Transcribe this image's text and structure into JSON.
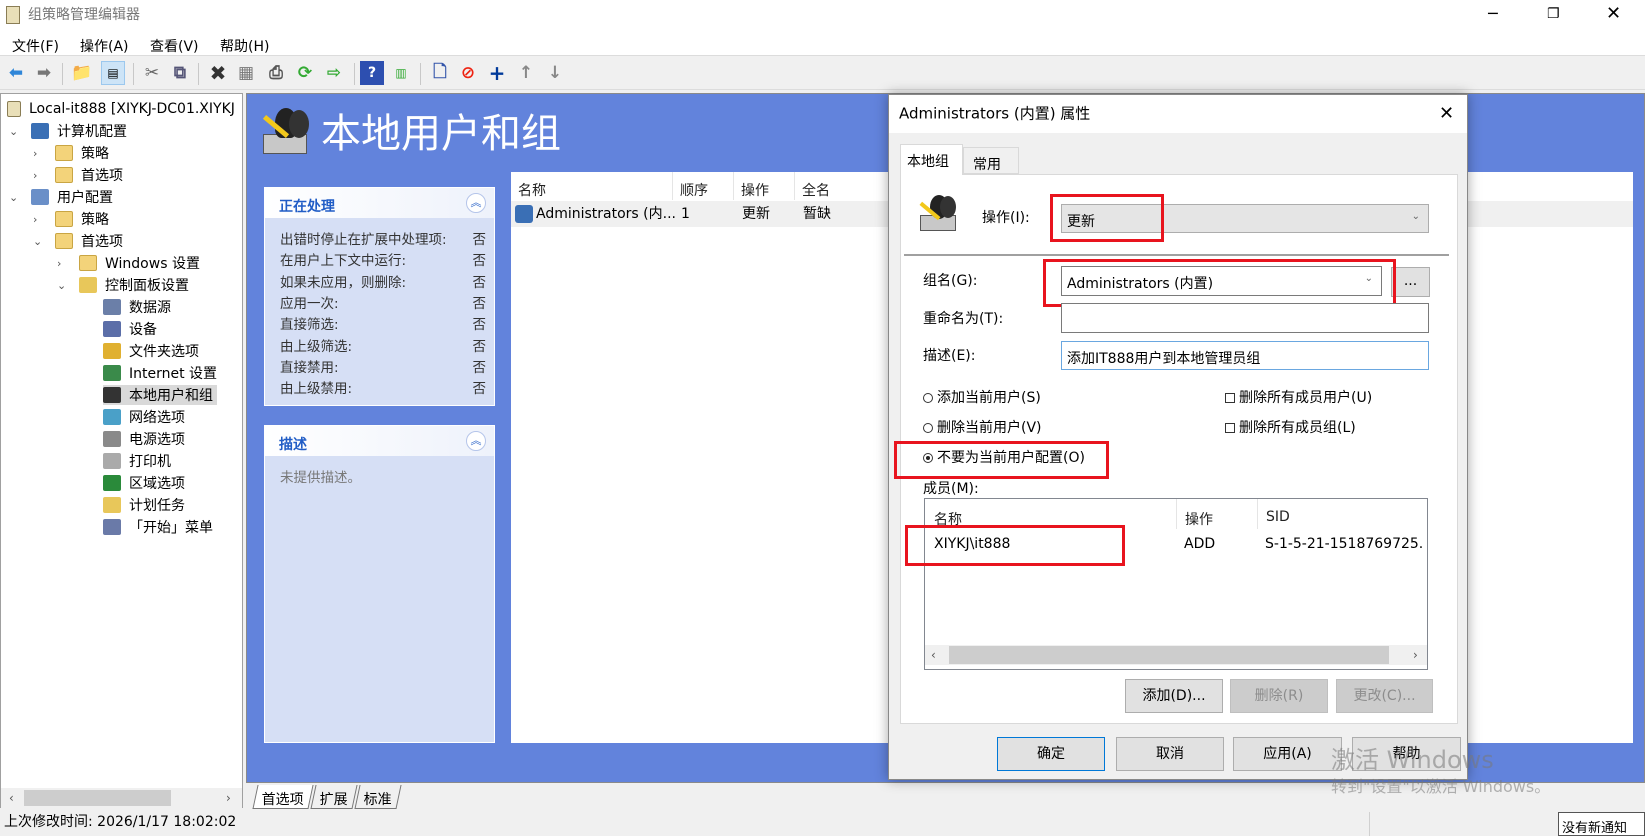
{
  "window": {
    "title": "组策略管理编辑器"
  },
  "menu": [
    "文件(F)",
    "操作(A)",
    "查看(V)",
    "帮助(H)"
  ],
  "toolbar": [
    "back-icon",
    "forward-icon",
    "up-folder-icon",
    "show-hide-tree-icon",
    "cut-icon",
    "copy-icon",
    "delete-icon",
    "properties-icon",
    "print-icon",
    "refresh-icon",
    "export-icon",
    "help-icon",
    "action-pane-icon",
    "new-item-icon",
    "disable-icon",
    "add-icon",
    "move-up-icon",
    "move-down-icon"
  ],
  "tree": {
    "root": "Local-it888 [XIYKJ-DC01.XIYKJ",
    "items": [
      {
        "label": "计算机配置"
      },
      {
        "label": "策略"
      },
      {
        "label": "首选项"
      },
      {
        "label": "用户配置"
      },
      {
        "label": "策略"
      },
      {
        "label": "首选项"
      },
      {
        "label": "Windows 设置"
      },
      {
        "label": "控制面板设置"
      },
      {
        "label": "数据源"
      },
      {
        "label": "设备"
      },
      {
        "label": "文件夹选项"
      },
      {
        "label": "Internet 设置"
      },
      {
        "label": "本地用户和组"
      },
      {
        "label": "网络选项"
      },
      {
        "label": "电源选项"
      },
      {
        "label": "打印机"
      },
      {
        "label": "区域选项"
      },
      {
        "label": "计划任务"
      },
      {
        "label": "「开始」菜单"
      }
    ]
  },
  "main": {
    "heading": "本地用户和组",
    "processing": {
      "title": "正在处理",
      "rows": [
        {
          "label": "出错时停止在扩展中处理项:",
          "value": "否"
        },
        {
          "label": "在用户上下文中运行:",
          "value": "否"
        },
        {
          "label": "如果未应用，则删除:",
          "value": "否"
        },
        {
          "label": "应用一次:",
          "value": "否"
        },
        {
          "label": "直接筛选:",
          "value": "否"
        },
        {
          "label": "由上级筛选:",
          "value": "否"
        },
        {
          "label": "直接禁用:",
          "value": "否"
        },
        {
          "label": "由上级禁用:",
          "value": "否"
        }
      ]
    },
    "description": {
      "title": "描述",
      "text": "未提供描述。"
    },
    "list": {
      "columns": [
        "名称",
        "顺序",
        "操作",
        "全名"
      ],
      "rows": [
        {
          "name": "Administrators (内...",
          "order": "1",
          "action": "更新",
          "fullname": "暂缺"
        }
      ]
    },
    "tabs": [
      "首选项",
      "扩展",
      "标准"
    ]
  },
  "status": {
    "text": "上次修改时间: 2026/1/17 18:02:02",
    "notification": "没有新通知"
  },
  "watermark": {
    "line1": "激活 Windows",
    "line2": "转到\"设置\"以激活 Windows。"
  },
  "dialog": {
    "title": "Administrators (内置) 属性",
    "tabs": [
      "本地组",
      "常用"
    ],
    "action_label": "操作(I):",
    "action_value": "更新",
    "group_label": "组名(G):",
    "group_value": "Administrators (内置)",
    "browse": "...",
    "rename_label": "重命名为(T):",
    "rename_value": "",
    "desc_label": "描述(E):",
    "desc_value": "添加IT888用户到本地管理员组",
    "radios": [
      {
        "label": "添加当前用户(S)",
        "checked": false
      },
      {
        "label": "删除当前用户(V)",
        "checked": false
      },
      {
        "label": "不要为当前用户配置(O)",
        "checked": true
      }
    ],
    "checks": [
      {
        "label": "删除所有成员用户(U)",
        "checked": false
      },
      {
        "label": "删除所有成员组(L)",
        "checked": false
      }
    ],
    "members_label": "成员(M):",
    "members_columns": [
      "名称",
      "操作",
      "SID"
    ],
    "members": [
      {
        "name": "XIYKJ\\it888",
        "action": "ADD",
        "sid": "S-1-5-21-1518769725."
      }
    ],
    "member_buttons": [
      "添加(D)...",
      "删除(R)",
      "更改(C)..."
    ],
    "buttons": [
      "确定",
      "取消",
      "应用(A)",
      "帮助"
    ]
  },
  "colors": {
    "panel_blue": "#6283dc",
    "highlight_red": "#e8141e",
    "link_blue": "#215dc6"
  }
}
